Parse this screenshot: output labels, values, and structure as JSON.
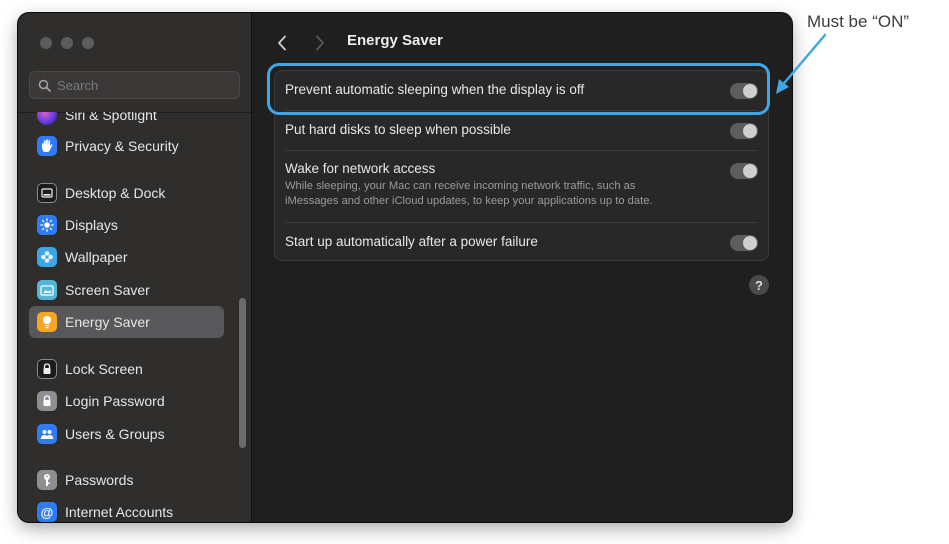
{
  "search": {
    "placeholder": "Search"
  },
  "sidebar": {
    "items": [
      {
        "label": "Siri & Spotlight",
        "icon": "siri-icon",
        "color": "#8e3aa8"
      },
      {
        "label": "Privacy & Security",
        "icon": "hand-icon",
        "color": "#2f7cf6"
      },
      {
        "label": "Desktop & Dock",
        "icon": "dock-icon",
        "color": "#1c1c1c"
      },
      {
        "label": "Displays",
        "icon": "sun-icon",
        "color": "#2f7cf6"
      },
      {
        "label": "Wallpaper",
        "icon": "flower-icon",
        "color": "#3ba7e8"
      },
      {
        "label": "Screen Saver",
        "icon": "screen-saver-icon",
        "color": "#53b6d8"
      },
      {
        "label": "Energy Saver",
        "icon": "lightbulb-icon",
        "color": "#f6a623",
        "selected": true
      },
      {
        "label": "Lock Screen",
        "icon": "lock-icon",
        "color": "#1c1c1c"
      },
      {
        "label": "Login Password",
        "icon": "padlock-icon",
        "color": "#8e8e93"
      },
      {
        "label": "Users & Groups",
        "icon": "users-icon",
        "color": "#2f7cf6"
      },
      {
        "label": "Passwords",
        "icon": "key-icon",
        "color": "#8e8e93"
      },
      {
        "label": "Internet Accounts",
        "icon": "at-icon",
        "color": "#2f7cf6"
      }
    ]
  },
  "header": {
    "title": "Energy Saver"
  },
  "settings": [
    {
      "title": "Prevent automatic sleeping when the display is off",
      "toggle": "on"
    },
    {
      "title": "Put hard disks to sleep when possible",
      "toggle": "on"
    },
    {
      "title": "Wake for network access",
      "description_lines": [
        "While sleeping, your Mac can receive incoming network traffic, such as",
        "iMessages and other iCloud updates, to keep your applications up to date."
      ],
      "toggle": "on"
    },
    {
      "title": "Start up automatically after a power failure",
      "toggle": "on"
    }
  ],
  "help": {
    "label": "?"
  },
  "annotation": {
    "text": "Must be “ON”",
    "color": "#40a6e6"
  }
}
